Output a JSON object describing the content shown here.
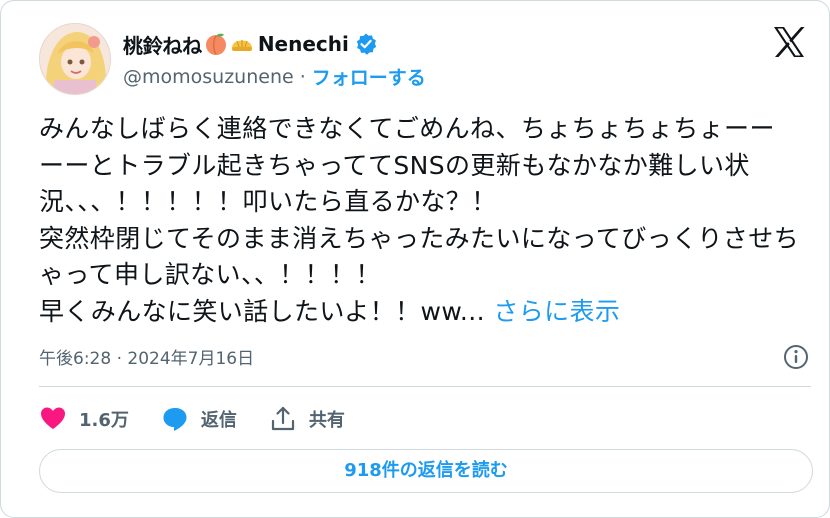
{
  "user": {
    "display_name": "桃鈴ねね",
    "display_name_suffix": "Nenechi",
    "handle": "@momosuzunene",
    "separator": "·",
    "follow_label": "フォローする",
    "emoji": [
      "peach-emoji",
      "melon-bun-emoji"
    ]
  },
  "tweet": {
    "text": "みんなしばらく連絡できなくてごめんね、ちょちょちょちょーーーーとトラブル起きちゃっててSNSの更新もなかなか難しい状況、、、！！！！！叩いたら直るかな？！\n突然枠閉じてそのまま消えちゃったみたいになってびっくりさせちゃって申し訳ない、、！！！！\n早くみんなに笑い話したいよ！！ww...",
    "show_more": "さらに表示",
    "timestamp": "午後6:28 · 2024年7月16日"
  },
  "actions": {
    "likes": "1.6万",
    "reply_label": "返信",
    "share_label": "共有"
  },
  "read_replies": "918件の返信を読む",
  "colors": {
    "accent": "#1d9bf0",
    "like": "#f91880",
    "text": "#0f1419",
    "muted": "#536471",
    "border": "#cfd9de"
  }
}
